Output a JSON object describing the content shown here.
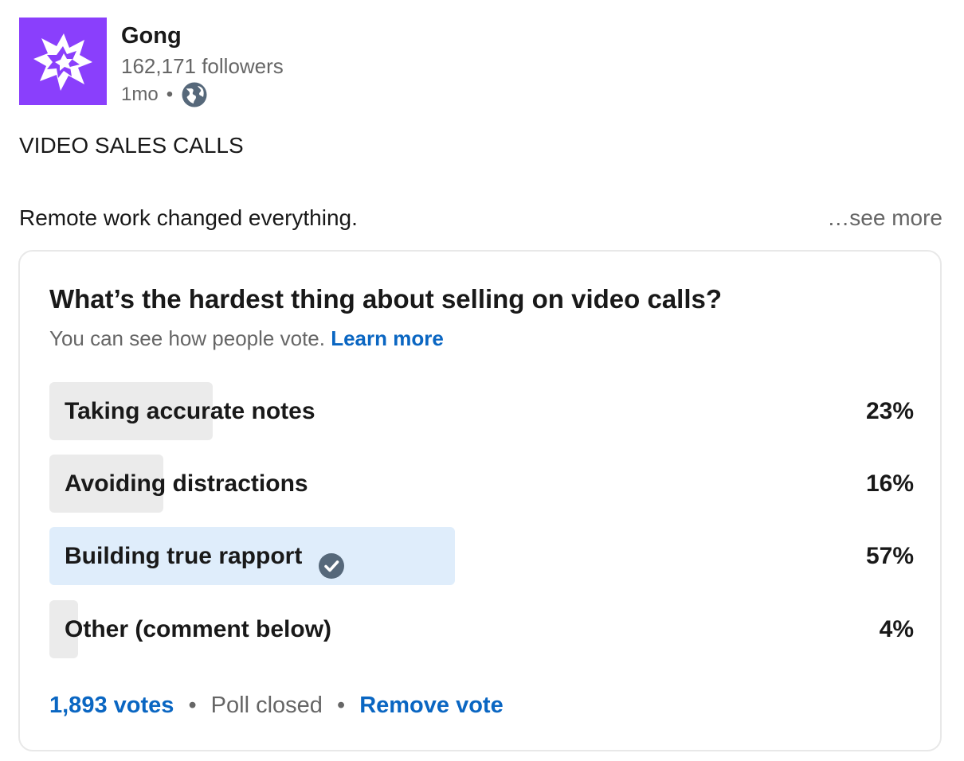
{
  "author": {
    "name": "Gong",
    "followers": "162,171 followers",
    "posted": "1mo",
    "separator": "•",
    "visibility_icon": "globe-icon",
    "logo_icon": "gong-starburst-logo",
    "logo_color": "#8a3ffc"
  },
  "post": {
    "headline": "VIDEO SALES CALLS",
    "body": "Remote work changed everything.",
    "see_more": "…see more"
  },
  "poll": {
    "question": "What’s the hardest thing about selling on video calls?",
    "note": "You can see how people vote.",
    "learn_more": "Learn more",
    "options": [
      {
        "label": "Taking accurate notes",
        "percent": "23%",
        "value": 23,
        "selected": false
      },
      {
        "label": "Avoiding distractions",
        "percent": "16%",
        "value": 16,
        "selected": false
      },
      {
        "label": "Building true rapport",
        "percent": "57%",
        "value": 57,
        "selected": true
      },
      {
        "label": "Other (comment below)",
        "percent": "4%",
        "value": 4,
        "selected": false
      }
    ],
    "votes": "1,893 votes",
    "separator": "•",
    "status": "Poll closed",
    "remove_vote": "Remove vote",
    "colors": {
      "bar": "#ebebeb",
      "selected_bar": "#dfedfb",
      "link": "#0a66c2",
      "check": "#56687a"
    }
  }
}
